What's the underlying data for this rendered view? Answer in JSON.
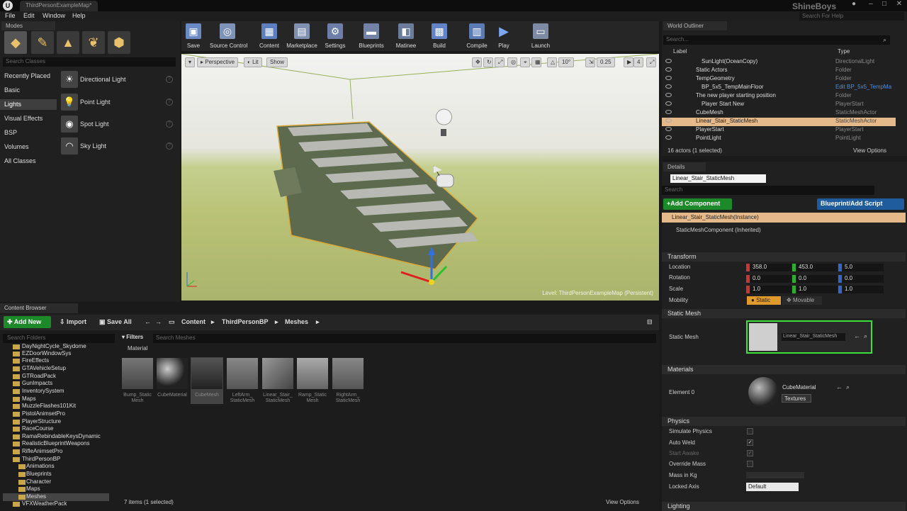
{
  "window": {
    "tab_title": "ThirdPersonExampleMap*",
    "brand": "ShineBoys",
    "help_search_placeholder": "Search For Help"
  },
  "menu": [
    "File",
    "Edit",
    "Window",
    "Help"
  ],
  "modes": {
    "tab_label": "Modes",
    "search_placeholder": "Search Classes",
    "categories": [
      "Recently Placed",
      "Basic",
      "Lights",
      "Visual Effects",
      "BSP",
      "Volumes",
      "All Classes"
    ],
    "selected_category": "Lights",
    "assets": [
      {
        "label": "Directional Light",
        "icon": "directional-light-icon"
      },
      {
        "label": "Point Light",
        "icon": "point-light-icon"
      },
      {
        "label": "Spot Light",
        "icon": "spot-light-icon"
      },
      {
        "label": "Sky Light",
        "icon": "sky-light-icon"
      }
    ]
  },
  "toolbar": {
    "buttons": [
      {
        "label": "Save",
        "icon": "save-icon"
      },
      {
        "label": "Source Control",
        "icon": "source-control-icon"
      },
      {
        "label": "Content",
        "icon": "content-icon"
      },
      {
        "label": "Marketplace",
        "icon": "marketplace-icon"
      },
      {
        "label": "Settings",
        "icon": "settings-icon"
      },
      {
        "label": "Blueprints",
        "icon": "blueprints-icon"
      },
      {
        "label": "Matinee",
        "icon": "matinee-icon"
      },
      {
        "label": "Build",
        "icon": "build-icon"
      },
      {
        "label": "Compile",
        "icon": "compile-icon"
      },
      {
        "label": "Play",
        "icon": "play-icon"
      },
      {
        "label": "Launch",
        "icon": "launch-icon"
      }
    ]
  },
  "viewport": {
    "perspective_label": "Perspective",
    "lit_label": "Lit",
    "show_label": "Show",
    "rotation_snap": "10°",
    "scale_snap": "0.25",
    "camera_speed": "4",
    "level_text": "Level:  ThirdPersonExampleMap (Persistent)"
  },
  "outliner": {
    "tab_label": "World Outliner",
    "search_placeholder": "Search...",
    "col_label": "Label",
    "col_type": "Type",
    "rows": [
      {
        "name": "SunLight(OceanCopy)",
        "type": "DirectionalLight"
      },
      {
        "name": "Static Actors",
        "type": "Folder"
      },
      {
        "name": "TempGeometry",
        "type": "Folder"
      },
      {
        "name": "BP_5x5_TempMainFloor",
        "type": "Edit BP_5x5_TempMa"
      },
      {
        "name": "The new player starting position",
        "type": "Folder"
      },
      {
        "name": "Player Start New",
        "type": "PlayerStart"
      },
      {
        "name": "CubeMesh",
        "type": "StaticMeshActor"
      },
      {
        "name": "Linear_Stair_StaticMesh",
        "type": "StaticMeshActor"
      },
      {
        "name": "PlayerStart",
        "type": "PlayerStart"
      },
      {
        "name": "PointLight",
        "type": "PointLight"
      }
    ],
    "status": "16 actors (1 selected)",
    "view_options": "View Options"
  },
  "details": {
    "tab_label": "Details",
    "name_value": "Linear_Stair_StaticMesh",
    "search_placeholder": "Search",
    "add_component": "+Add Component",
    "blueprint_script": "Blueprint/Add Script",
    "instance_label": "Linear_Stair_StaticMesh(Instance)",
    "component_label": "StaticMeshComponent (Inherited)",
    "transform": {
      "title": "Transform",
      "location_label": "Location",
      "rotation_label": "Rotation",
      "scale_label": "Scale",
      "mobility_label": "Mobility",
      "location": [
        "358.0",
        "453.0",
        "5.0"
      ],
      "rotation": [
        "0.0",
        "0.0",
        "0.0"
      ],
      "scale": [
        "1.0",
        "1.0",
        "1.0"
      ],
      "mobility_static": "Static",
      "mobility_movable": "Movable"
    },
    "static_mesh": {
      "title": "Static Mesh",
      "label": "Static Mesh",
      "value": "Linear_Stair_StaticMesh"
    },
    "materials": {
      "title": "Materials",
      "label": "Element 0",
      "value": "CubeMaterial",
      "textures": "Textures"
    },
    "physics": {
      "title": "Physics",
      "simulate": "Simulate Physics",
      "auto_weld": "Auto Weld",
      "start_awake": "Start Awake",
      "override_mass": "Override Mass",
      "mass_in_kg": "Mass in Kg",
      "locked_axis": "Locked Axis",
      "locked_axis_value": "Default"
    },
    "lighting_title": "Lighting"
  },
  "content_browser": {
    "tab_label": "Content Browser",
    "add_new": "Add New",
    "import": "Import",
    "save_all": "Save All",
    "breadcrumb": [
      "Content",
      "ThirdPersonBP",
      "Meshes"
    ],
    "folder_search_placeholder": "Search Folders",
    "folders": [
      "DayNightCycle_Skydome",
      "EZDoorWindowSys",
      "FireEffects",
      "GTAVehicleSetup",
      "GTRoadPack",
      "GunImpacts",
      "InventorySystem",
      "Maps",
      "MuzzleFlashes101Kit",
      "PistolAnimsetPro",
      "PlayerStructure",
      "RaceCourse",
      "RamaRebindableKeysDynamic",
      "RealisticBlueprintWeapons",
      "RifleAnimsetPro",
      "ThirdPersonBP",
      "Animations",
      "Blueprints",
      "Character",
      "Maps",
      "Meshes",
      "VFXWeatherPack"
    ],
    "filters": "Filters",
    "mesh_search_placeholder": "Search Meshes",
    "category": "Material",
    "assets": [
      "Bump_Static Mesh",
      "CubeMaterial",
      "CubeMesh",
      "LeftArm_ StaticMesh",
      "Linear_Stair_ StaticMesh",
      "Ramp_Static Mesh",
      "RightArm_ StaticMesh"
    ],
    "status": "7 items (1 selected)",
    "view_options": "View Options"
  }
}
